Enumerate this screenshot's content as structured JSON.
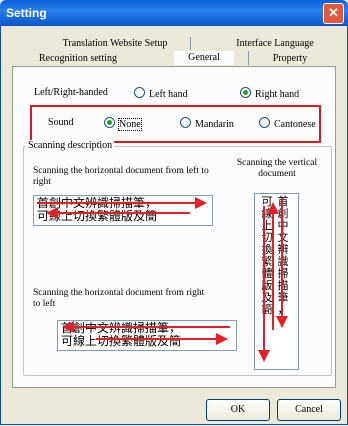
{
  "window": {
    "title": "Setting",
    "close_glyph": "✕"
  },
  "tabs": {
    "row1": [
      "Translation Website Setup",
      "Interface Language"
    ],
    "row2": [
      "Recognition setting",
      "General",
      "Property"
    ],
    "active": "General"
  },
  "handed": {
    "label": "Left/Right-handed",
    "options": [
      "Left hand",
      "Right hand"
    ],
    "selected": "Right hand"
  },
  "sound": {
    "label": "Sound",
    "options": [
      "None",
      "Mandarin",
      "Cantonese"
    ],
    "selected": "None"
  },
  "scanning": {
    "legend": "Scanning description",
    "h_ltr_caption": "Scanning the horizontal document from left to right",
    "h_rtl_caption": "Scanning the horizontal document from right to left",
    "v_caption": "Scanning the vertical document",
    "sample_lines": [
      "首創中文辨識掃描筆，",
      "可線上切換繁體版及簡"
    ]
  },
  "buttons": {
    "ok": "OK",
    "cancel": "Cancel"
  },
  "colors": {
    "titlebar": "#0a5fd8",
    "highlight": "#d51c23",
    "arrow": "#e41f26"
  }
}
